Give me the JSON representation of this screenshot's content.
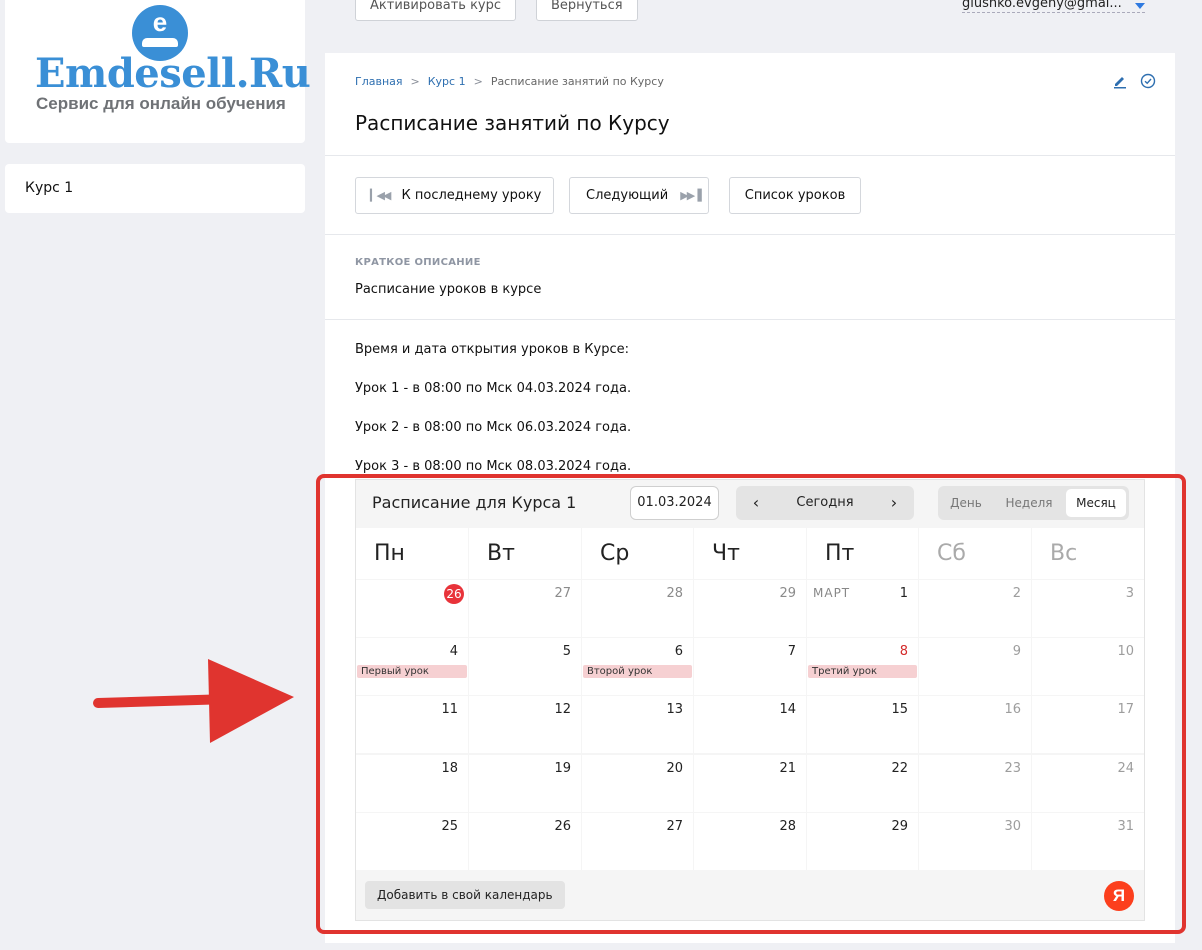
{
  "logo": {
    "title": "Emdesell.Ru",
    "subtitle": "Сервис для онлайн обучения",
    "badge_letter": "e"
  },
  "sidebar": {
    "items": [
      {
        "label": "Курс 1"
      }
    ]
  },
  "topbar": {
    "activate_label": "Активировать курс",
    "back_label": "Вернуться",
    "user_email": "glushko.evgeny@gmai..."
  },
  "breadcrumb": {
    "home": "Главная",
    "course": "Курс 1",
    "current": "Расписание занятий по Курсу",
    "separator": ">"
  },
  "page": {
    "title": "Расписание занятий по Курсу"
  },
  "nav": {
    "last_lesson": "К последнему уроку",
    "next": "Следующий",
    "lesson_list": "Список уроков"
  },
  "summary": {
    "label": "КРАТКОЕ ОПИСАНИЕ",
    "text": "Расписание уроков в курсе"
  },
  "content": {
    "lines": [
      "Время и дата открытия уроков в Курсе:",
      "Урок 1 - в 08:00 по Мск 04.03.2024 года.",
      "Урок 2 - в 08:00 по Мск 06.03.2024 года.",
      "Урок 3 - в 08:00 по Мск 08.03.2024 года."
    ]
  },
  "calendar": {
    "title": "Расписание для Курса 1",
    "date": "01.03.2024",
    "today_label": "Сегодня",
    "prev_icon": "chevron-left-icon",
    "next_icon": "chevron-right-icon",
    "views": [
      "День",
      "Неделя",
      "Месяц"
    ],
    "active_view": "Месяц",
    "weekdays": [
      "Пн",
      "Вт",
      "Ср",
      "Чт",
      "Пт",
      "Сб",
      "Вс"
    ],
    "month_label": "МАРТ",
    "weeks": [
      [
        "26",
        "27",
        "28",
        "29",
        "1",
        "2",
        "3"
      ],
      [
        "4",
        "5",
        "6",
        "7",
        "8",
        "9",
        "10"
      ],
      [
        "11",
        "12",
        "13",
        "14",
        "15",
        "16",
        "17"
      ],
      [
        "18",
        "19",
        "20",
        "21",
        "22",
        "23",
        "24"
      ],
      [
        "25",
        "26",
        "27",
        "28",
        "29",
        "30",
        "31"
      ]
    ],
    "events": {
      "4": "Первый урок",
      "6": "Второй урок",
      "8": "Третий урок"
    },
    "add_label": "Добавить в свой календарь",
    "yandex_letter": "Я",
    "accent": "#e8333a"
  },
  "annotation": {
    "color": "#e0342f"
  }
}
